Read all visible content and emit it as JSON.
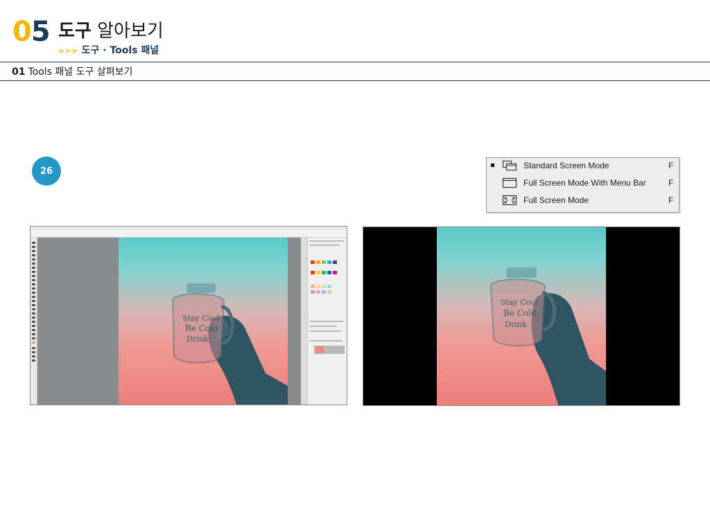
{
  "header": {
    "chapter_number_lead": "0",
    "chapter_number_tail": "5",
    "chapter_title_bold": "도구",
    "chapter_title_rest": "알아보기",
    "subtitle_prefix": ">>>",
    "subtitle": "도구 · Tools 패널"
  },
  "section": {
    "number": "01",
    "title": "Tools 패널 도구 살펴보기"
  },
  "page_badge": "26",
  "screen_mode_menu": {
    "items": [
      {
        "label": "Standard Screen Mode",
        "shortcut": "F",
        "selected": true,
        "icon": "standard-screen-mode-icon"
      },
      {
        "label": "Full Screen Mode With Menu Bar",
        "shortcut": "F",
        "selected": false,
        "icon": "full-screen-menu-bar-icon"
      },
      {
        "label": "Full Screen Mode",
        "shortcut": "F",
        "selected": false,
        "icon": "full-screen-mode-icon"
      }
    ]
  },
  "colors": {
    "accent_yellow": "#f2b705",
    "navy": "#1e3a5a",
    "badge_blue": "#2598c8"
  }
}
